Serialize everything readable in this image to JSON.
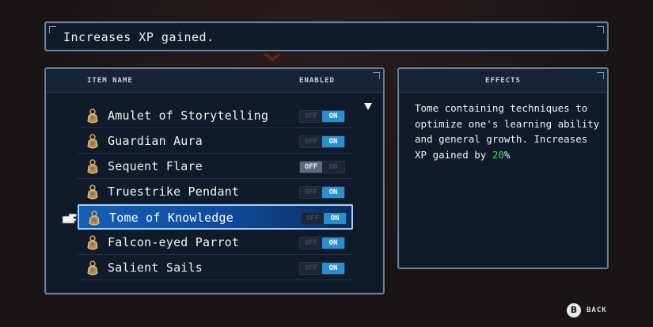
{
  "description": {
    "text": "Increases XP gained."
  },
  "list": {
    "header_item_name": "ITEM NAME",
    "header_enabled": "ENABLED",
    "items": [
      {
        "name": "Amulet of Storytelling",
        "enabled": true
      },
      {
        "name": "Guardian Aura",
        "enabled": true
      },
      {
        "name": "Sequent Flare",
        "enabled": false
      },
      {
        "name": "Truestrike Pendant",
        "enabled": true
      },
      {
        "name": "Tome of Knowledge",
        "enabled": true,
        "selected": true
      },
      {
        "name": "Falcon-eyed Parrot",
        "enabled": true
      },
      {
        "name": "Salient Sails",
        "enabled": true
      }
    ],
    "toggle_off_label": "OFF",
    "toggle_on_label": "ON",
    "item_icon": "amulet-icon",
    "pointer_icon": "pointing-hand-icon",
    "scroll_icon": "scroll-down-arrow-icon"
  },
  "effects": {
    "header": "EFFECTS",
    "text_before": "Tome containing techniques to optimize one's learning ability and general growth. Increases XP gained by ",
    "value": "20",
    "text_after": "%",
    "value_color": "#3fd86a"
  },
  "footer": {
    "button_glyph": "B",
    "back_label": "BACK"
  },
  "colors": {
    "panel_bg": "#0f1a2a",
    "panel_border": "#6a7d92",
    "toggle_on": "#2a8fd0",
    "selection": "#1560b8"
  }
}
